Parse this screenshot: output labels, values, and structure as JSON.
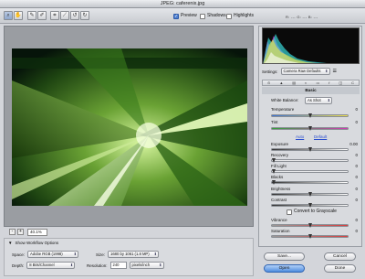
{
  "window": {
    "title": "JPEG: caferenix.jpg"
  },
  "toolbar": {
    "tools": [
      "zoom-tool",
      "hand-tool",
      "white-balance-tool",
      "color-sampler-tool",
      "crop-tool",
      "straighten-tool",
      "rotate-left",
      "rotate-right"
    ],
    "preview_label": "Preview",
    "preview_checked": true,
    "shadows_label": "Shadows",
    "shadows_checked": false,
    "highlights_label": "Highlights",
    "highlights_checked": false,
    "rgb_readout": "R:  ---   G:  ---   B:  ---"
  },
  "zoom": {
    "value": "40.1%",
    "minus": "-",
    "plus": "+"
  },
  "workflow": {
    "show_label": "Show Workflow Options",
    "space_label": "Space:",
    "space_value": "Adobe RGB (1998)",
    "size_label": "Size:",
    "size_value": "1680 by 1061 (1.8 MP)",
    "depth_label": "Depth:",
    "depth_value": "8 Bits/Channel",
    "resolution_label": "Resolution:",
    "resolution_value": "240",
    "resolution_unit": "pixels/inch"
  },
  "panel": {
    "settings_label": "Settings:",
    "settings_value": "Camera Raw Defaults",
    "tabs": [
      "⊙",
      "▲",
      "▤",
      "◐",
      "▭",
      "f",
      "◫",
      "C"
    ],
    "section_title": "Basic",
    "white_balance_label": "White Balance:",
    "white_balance_value": "As Shot",
    "temperature_label": "Temperature",
    "temperature_value": "0",
    "tint_label": "Tint",
    "tint_value": "0",
    "auto_label": "Auto",
    "default_label": "Default",
    "exposure_label": "Exposure",
    "exposure_value": "0.00",
    "recovery_label": "Recovery",
    "recovery_value": "0",
    "fill_light_label": "Fill Light",
    "fill_light_value": "0",
    "blacks_label": "Blacks",
    "blacks_value": "0",
    "brightness_label": "Brightness",
    "brightness_value": "0",
    "contrast_label": "Contrast",
    "contrast_value": "0",
    "grayscale_label": "Convert to Grayscale",
    "vibrance_label": "Vibrance",
    "vibrance_value": "0",
    "saturation_label": "Saturation",
    "saturation_value": "0"
  },
  "buttons": {
    "save": "Save...",
    "cancel": "Cancel",
    "open": "Open",
    "done": "Done"
  },
  "colors": {
    "accent": "#4f8ddf",
    "link": "#2a4ecf"
  }
}
